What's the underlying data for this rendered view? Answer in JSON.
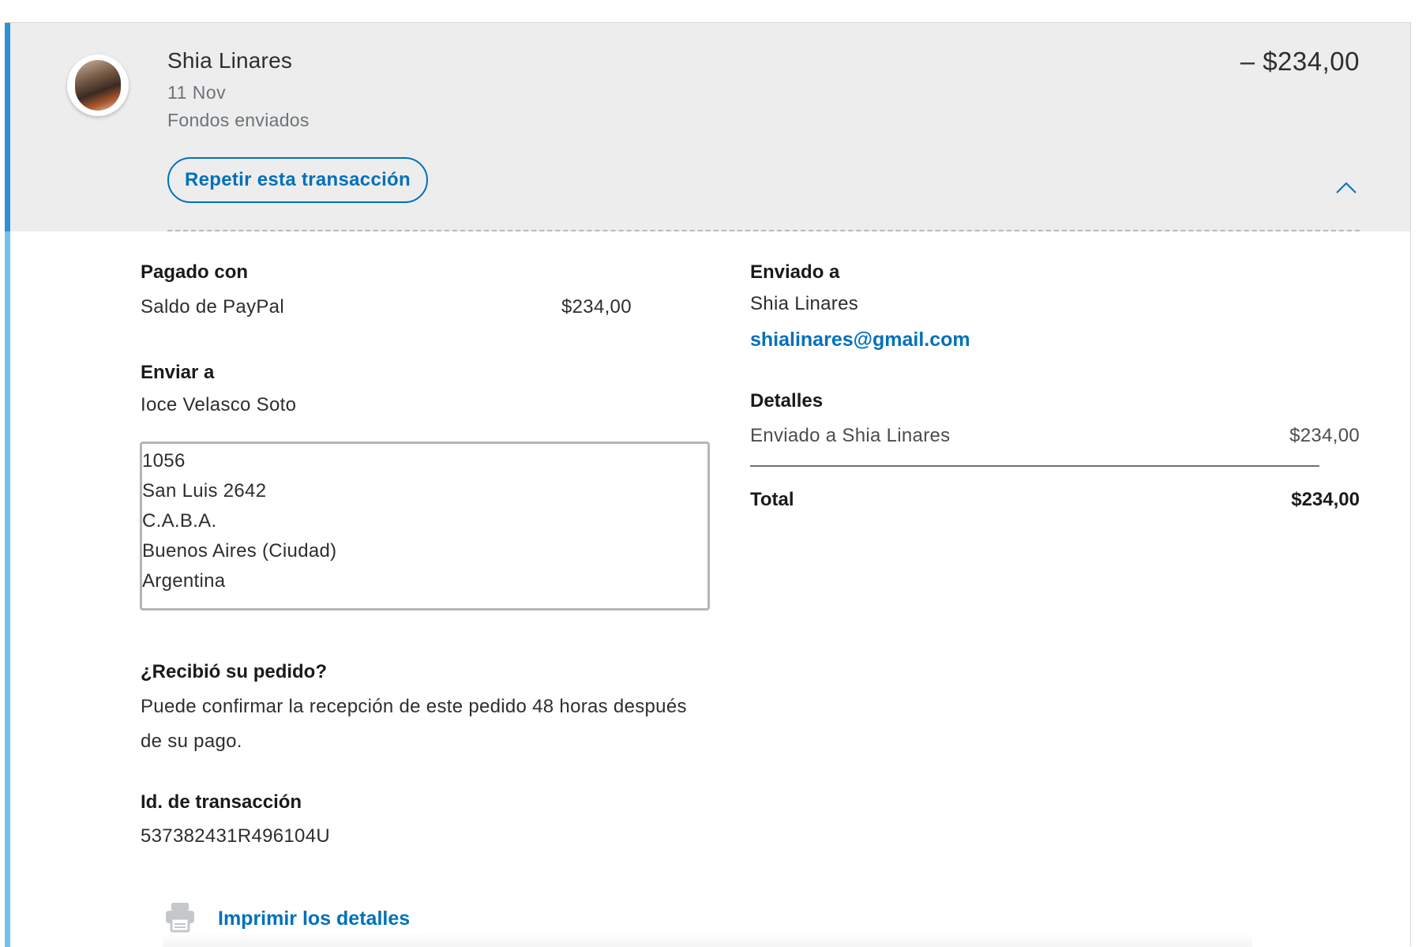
{
  "transaction": {
    "name": "Shia Linares",
    "date": "11 Nov",
    "status": "Fondos enviados",
    "amount": "– $234,00",
    "repeat_label": "Repetir esta transacción"
  },
  "paid_with": {
    "label": "Pagado con",
    "method": "Saldo de PayPal",
    "amount": "$234,00"
  },
  "ship_to": {
    "label": "Enviar a",
    "name": "Ioce Velasco Soto",
    "address_lines": [
      "1056",
      "San Luis 2642",
      "C.A.B.A.",
      "Buenos Aires (Ciudad)",
      "Argentina"
    ]
  },
  "order_received": {
    "label": "¿Recibió su pedido?",
    "line1": "Puede confirmar la recepción de este pedido 48 horas después",
    "line2": "de su pago."
  },
  "transaction_id": {
    "label": "Id. de transacción",
    "value": "537382431R496104U"
  },
  "sent_to": {
    "label": "Enviado a",
    "name": "Shia Linares",
    "email": "shialinares@gmail.com"
  },
  "details": {
    "label": "Detalles",
    "line_label": "Enviado a Shia Linares",
    "line_amount": "$234,00",
    "total_label": "Total",
    "total_amount": "$234,00"
  },
  "print": {
    "label": "Imprimir los detalles"
  },
  "icons": {
    "chevron": "chevron-up-icon",
    "print": "printer-icon",
    "avatar": "avatar"
  },
  "colors": {
    "accent_dark": "#2f8fd5",
    "accent_light": "#74c1ea",
    "link": "#0070ba",
    "header_bg": "#ededed"
  }
}
